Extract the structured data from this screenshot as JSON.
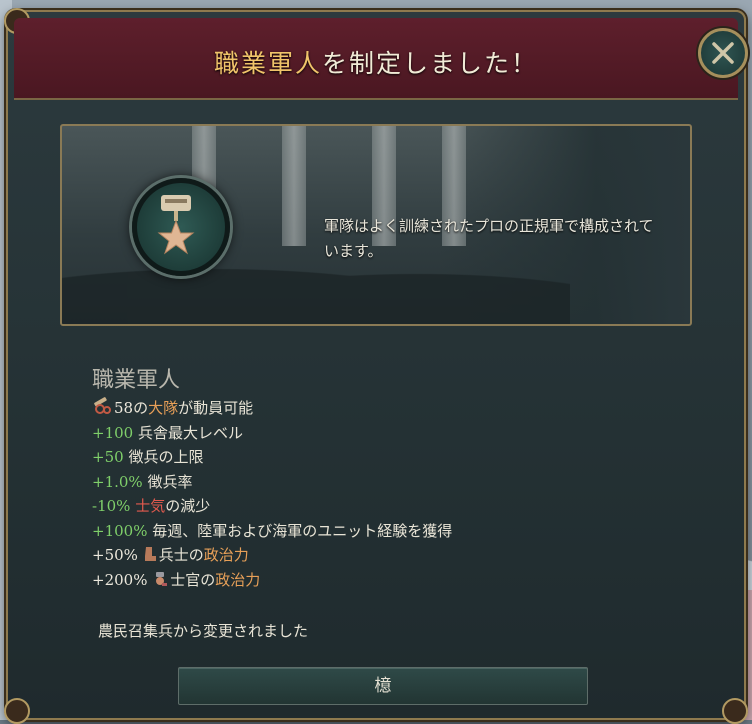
{
  "dialog": {
    "title_highlight": "職業軍人",
    "title_rest": "を制定しました！",
    "banner_text": "軍隊はよく訓練されたプロの正規軍で構成されています。",
    "law_name": "職業軍人",
    "effects": [
      {
        "value": "58",
        "mid": "の",
        "label_hl": "大隊",
        "tail": "が動員可能"
      },
      {
        "value": "+100",
        "label": "兵舎最大レベル"
      },
      {
        "value": "+50",
        "label": "徴兵の上限"
      },
      {
        "value": "+1.0%",
        "label": "徴兵率"
      },
      {
        "value": "-10%",
        "label_hl": "士気",
        "tail": "の減少"
      },
      {
        "value": "+100%",
        "label": "毎週、陸軍および海軍のユニット経験を獲得"
      },
      {
        "value": "+50%",
        "label_pre": "兵士の",
        "label_hl": "政治力"
      },
      {
        "value": "+200%",
        "label_pre": "士官の",
        "label_hl": "政治力"
      }
    ],
    "changed_from": "農民召集兵から変更されました",
    "ok_label": "檍"
  },
  "icons": {
    "close": "close-icon",
    "medal": "medal-star-icon",
    "battalion": "cannon-icon",
    "soldier": "boot-icon",
    "officer": "officer-icon"
  },
  "colors": {
    "header": "#5e1f2c",
    "panel": "#243134",
    "border": "#8e7a4e",
    "positive": "#7fcf6a",
    "negative": "#e25a4e",
    "highlight": "#e8a058"
  }
}
